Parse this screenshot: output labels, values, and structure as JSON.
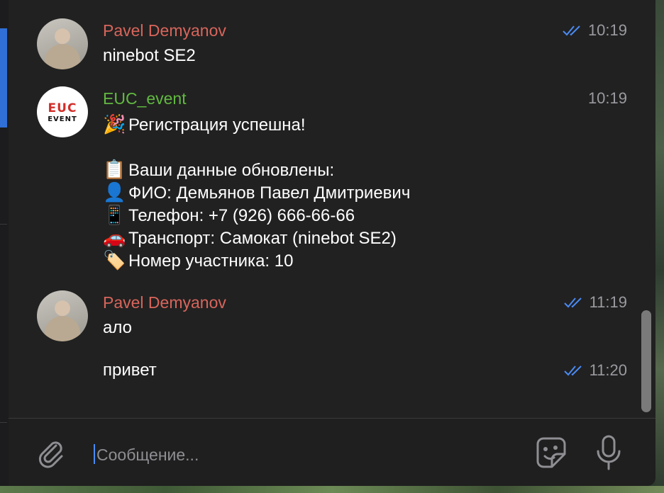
{
  "messages": [
    {
      "sender": "Pavel Demyanov",
      "text": "ninebot SE2",
      "time": "10:19",
      "read": true
    },
    {
      "sender": "EUC_event",
      "logo_top": "EUC",
      "logo_bottom": "EVENT",
      "time": "10:19",
      "lines": [
        {
          "icon": "🎉",
          "text": "Регистрация успешна!"
        },
        {
          "icon": "📋",
          "text": "Ваши данные обновлены:"
        },
        {
          "icon": "👤",
          "text": "ФИО: Демьянов Павел Дмитриевич"
        },
        {
          "icon": "📱",
          "text": "Телефон: +7 (926) 666-66-66"
        },
        {
          "icon": "🚗",
          "text": "Транспорт: Самокат (ninebot SE2)"
        },
        {
          "icon": "🏷️",
          "text": "Номер участника: 10"
        }
      ]
    },
    {
      "sender": "Pavel Demyanov",
      "text": "ало",
      "time": "11:19",
      "read": true
    },
    {
      "text": "привет",
      "time": "11:20",
      "read": true
    }
  ],
  "composer": {
    "placeholder": "Сообщение...",
    "value": ""
  },
  "colors": {
    "background": "#212121",
    "pavel_name": "#d8655b",
    "euc_name": "#61b940",
    "read_check": "#4a8bf5",
    "time": "#9a9aa0"
  },
  "icons": {
    "attach": "paperclip-icon",
    "emoji": "sticker-icon",
    "voice": "microphone-icon",
    "read": "double-check-icon"
  }
}
